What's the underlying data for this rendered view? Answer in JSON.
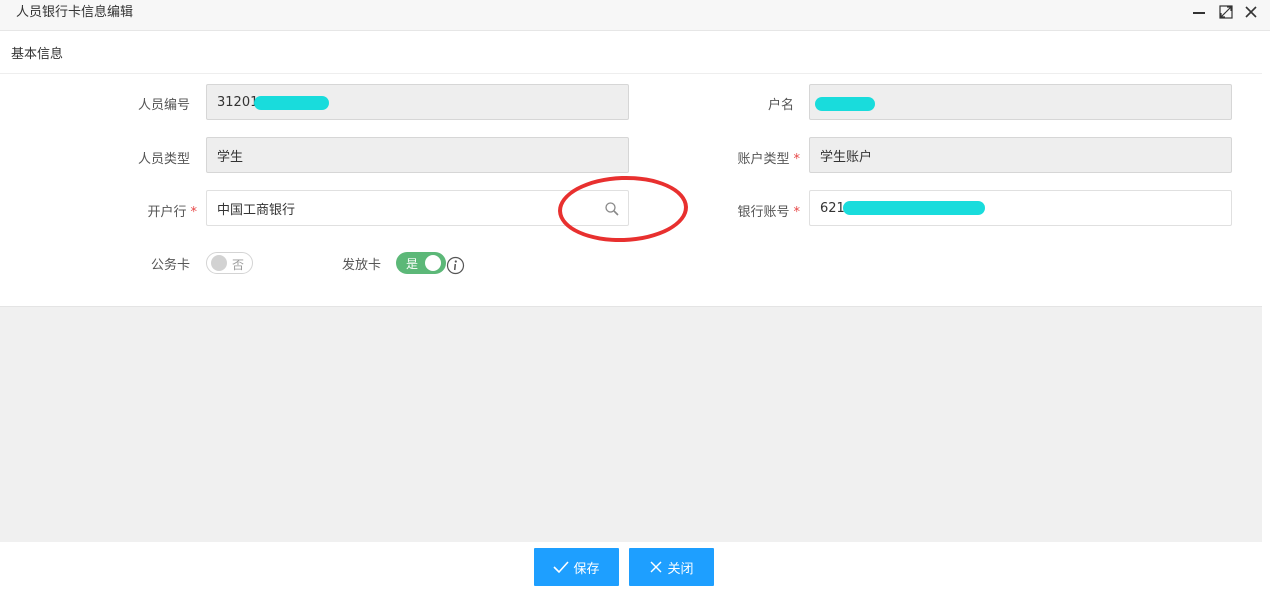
{
  "window": {
    "title": "人员银行卡信息编辑",
    "icons": [
      "minimize-icon",
      "maximize-icon",
      "close-icon"
    ]
  },
  "section": {
    "title": "基本信息"
  },
  "form": {
    "person_id": {
      "label": "人员编号",
      "value": "31201"
    },
    "account_name": {
      "label": "户名",
      "value": ""
    },
    "person_type": {
      "label": "人员类型",
      "value": "学生"
    },
    "account_type": {
      "label": "账户类型",
      "required_mark": "*",
      "value": "学生账户"
    },
    "bank": {
      "label": "开户行",
      "required_mark": "*",
      "value": "中国工商银行",
      "icon": "search-icon"
    },
    "bank_account": {
      "label": "银行账号",
      "required_mark": "*",
      "value": "621"
    },
    "official_card": {
      "label": "公务卡",
      "state": "否",
      "on": false
    },
    "issue_card": {
      "label": "发放卡",
      "state": "是",
      "on": true,
      "icon": "info-icon"
    }
  },
  "buttons": {
    "save": {
      "label": "保存",
      "icon": "check-icon"
    },
    "close": {
      "label": "关闭",
      "icon": "x-icon"
    }
  },
  "colors": {
    "primary_button": "#1e9fff",
    "switch_on": "#5cb878",
    "required": "#e64545",
    "annotation_circle": "#e8302f",
    "redaction": "#19dcdc"
  }
}
